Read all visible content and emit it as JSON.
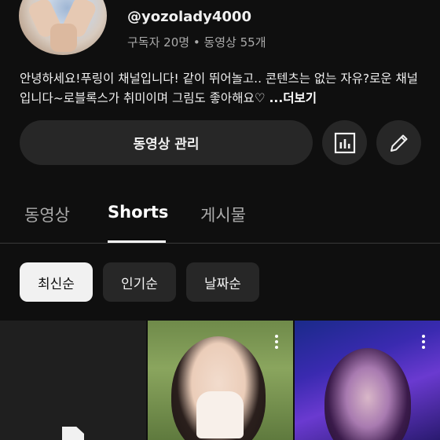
{
  "channel": {
    "handle": "@yozolady4000",
    "meta": "구독자 20명 • 동영상 55개",
    "description": "안녕하세요!푸링이 채널입니다! 같이 뛰어놀고.. 콘텐츠는 없는 자유?로운 채널입니다~로블록스가 취미이며 그림도 좋아해요♡",
    "more_label": "...더보기"
  },
  "actions": {
    "manage_label": "동영상 관리",
    "analytics_icon": "bar-chart-icon",
    "edit_icon": "pencil-icon"
  },
  "tabs": [
    {
      "label": "동영상",
      "active": false
    },
    {
      "label": "Shorts",
      "active": true
    },
    {
      "label": "게시물",
      "active": false
    }
  ],
  "sort_chips": [
    {
      "label": "최신순",
      "selected": true
    },
    {
      "label": "인기순",
      "selected": false
    },
    {
      "label": "날짜순",
      "selected": false
    }
  ],
  "colors": {
    "background": "#0f0f0f",
    "surface": "#272727",
    "text_secondary": "#aaaaaa"
  }
}
